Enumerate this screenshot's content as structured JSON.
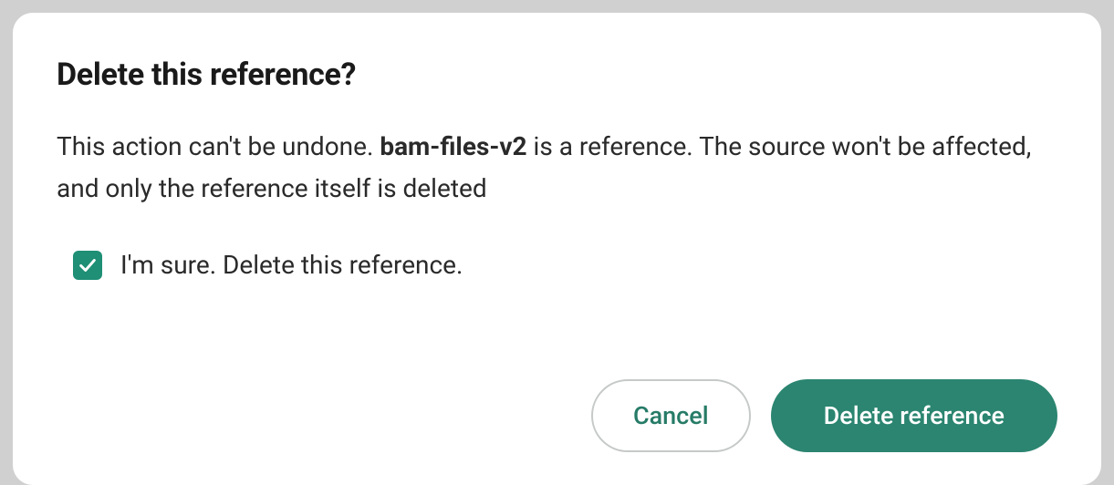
{
  "modal": {
    "title": "Delete this reference?",
    "body_prefix": "This action can't be undone. ",
    "reference_name": "bam-files-v2",
    "body_suffix": " is a reference. The source won't be affected, and only the reference itself is deleted",
    "confirm_label": "I'm sure. Delete this reference.",
    "confirm_checked": true,
    "cancel_label": "Cancel",
    "delete_label": "Delete reference"
  },
  "colors": {
    "accent": "#2b8570",
    "checkbox": "#1f8f75"
  }
}
